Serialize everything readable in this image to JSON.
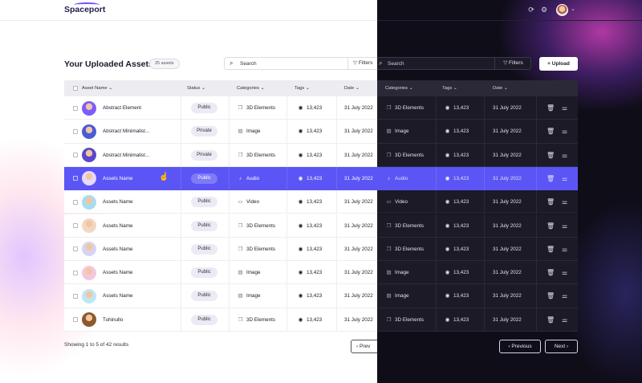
{
  "app": {
    "logo_text": "Spaceport"
  },
  "header": {
    "icons": [
      "refresh-icon",
      "settings-icon",
      "chevron-down-icon"
    ]
  },
  "page": {
    "title": "Your Uploaded Assets",
    "count_badge": "25 assets"
  },
  "toolbar": {
    "search_placeholder": "Search",
    "filters_label": "Filters",
    "upload_label": "Upload"
  },
  "table": {
    "columns": {
      "name": "Asset Name",
      "status": "Status",
      "categories": "Categories",
      "tags": "Tags",
      "date": "Date"
    },
    "rows": [
      {
        "name": "Abstract Element",
        "status": "Public",
        "category": "3D Elements",
        "category_icon": "cube-icon",
        "tags": "13,423",
        "date": "31 July 2022",
        "avatar_color": "#7c5cff"
      },
      {
        "name": "Abstract Minimalist...",
        "status": "Private",
        "category": "Image",
        "category_icon": "image-icon",
        "tags": "13,423",
        "date": "31 July 2022",
        "avatar_color": "#4b5bd6"
      },
      {
        "name": "Abstract Minimalist...",
        "status": "Private",
        "category": "3D Elements",
        "category_icon": "cube-icon",
        "tags": "13,423",
        "date": "31 July 2022",
        "avatar_color": "#5a49c9"
      },
      {
        "name": "Assets Name",
        "status": "Public",
        "category": "Audio",
        "category_icon": "music-note-icon",
        "tags": "13,423",
        "date": "31 July 2022",
        "avatar_color": "#e7d9ff",
        "highlighted": true
      },
      {
        "name": "Assets Name",
        "status": "Public",
        "category": "Video",
        "category_icon": "video-icon",
        "tags": "13,423",
        "date": "31 July 2022",
        "avatar_color": "#a8dcef"
      },
      {
        "name": "Assets Name",
        "status": "Public",
        "category": "3D Elements",
        "category_icon": "cube-icon",
        "tags": "13,423",
        "date": "31 July 2022",
        "avatar_color": "#f3d7c4"
      },
      {
        "name": "Assets Name",
        "status": "Public",
        "category": "3D Elements",
        "category_icon": "cube-icon",
        "tags": "13,423",
        "date": "31 July 2022",
        "avatar_color": "#d9d2f0"
      },
      {
        "name": "Assets Name",
        "status": "Public",
        "category": "Image",
        "category_icon": "image-icon",
        "tags": "13,423",
        "date": "31 July 2022",
        "avatar_color": "#f5c7df"
      },
      {
        "name": "Assets Name",
        "status": "Public",
        "category": "Image",
        "category_icon": "image-icon",
        "tags": "13,423",
        "date": "31 July 2022",
        "avatar_color": "#bfe6f3"
      },
      {
        "name": "Tuhinullo",
        "status": "Public",
        "category": "3D Elements",
        "category_icon": "cube-icon",
        "tags": "13,423",
        "date": "31 July 2022",
        "avatar_color": "#8b5a2b"
      }
    ]
  },
  "pagination": {
    "showing": "Showing 1 to 5 of 42 results",
    "prev_label": "Previous",
    "prev_label_clipped": "Prev",
    "next_label": "Next"
  },
  "colors": {
    "accent": "#5b55f5",
    "dark_bg": "#0f0d18",
    "glow_pink": "#e646d2"
  }
}
